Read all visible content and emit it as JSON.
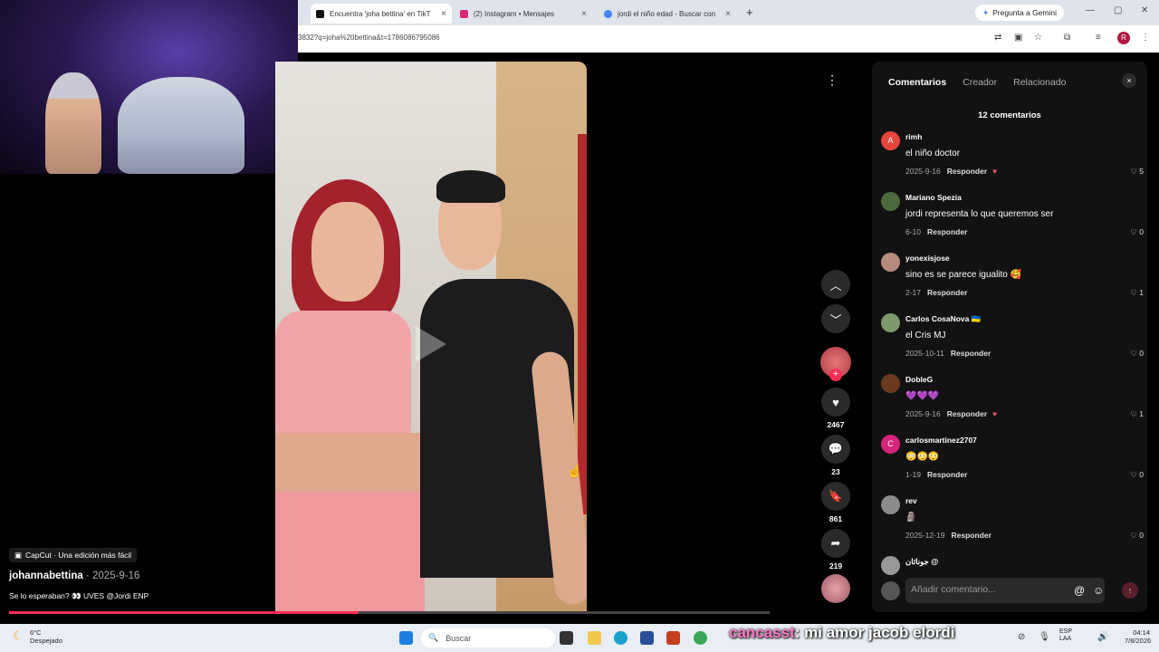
{
  "browser": {
    "tabs": [
      {
        "title": "Encuentra 'joha bettina' en TikT",
        "active": true
      },
      {
        "title": "(2) Instagram • Mensajes",
        "active": false
      },
      {
        "title": "jordi el niño edad - Buscar con",
        "active": false
      }
    ],
    "new_tab_glyph": "+",
    "gemini_label": "Pregunta a Gemini",
    "url": "3832?q=joha%20bettina&t=1786086795086",
    "profile_initial": "R",
    "close_glyph": "×"
  },
  "video": {
    "capcut_tag": "CapCut · Una edición más fácil",
    "author": "johannabettina",
    "date": "· 2025-9-16",
    "description": "Se lo esperaban? 👀 UVES @Jordi ENP",
    "progress": 0.46
  },
  "actions": {
    "likes": "2467",
    "comments": "23",
    "saves": "861",
    "shares": "219"
  },
  "panel": {
    "tabs": [
      "Comentarios",
      "Creador",
      "Relacionado"
    ],
    "count_label": "12 comentarios",
    "reply_label": "Responder",
    "input_placeholder": "Añadir comentario...",
    "comments": [
      {
        "user": "rimh",
        "text": "el niño doctor",
        "date": "2025-9-16",
        "likes": "5",
        "avatar": "A",
        "avatar_color": "#e8453c",
        "creator_liked": true
      },
      {
        "user": "Mariano Spezia",
        "text": "jordi representa lo que queremos ser",
        "date": "6-10",
        "likes": "0",
        "avatar": "",
        "avatar_color": "#4c6b3c",
        "creator_liked": false
      },
      {
        "user": "yonexisjose",
        "text": "sino es se parece igualito 🥰",
        "date": "2-17",
        "likes": "1",
        "avatar": "",
        "avatar_color": "#b88a7d",
        "creator_liked": false
      },
      {
        "user": "Carlos CosaNova 🇺🇦",
        "text": "el Cris MJ",
        "date": "2025-10-11",
        "likes": "0",
        "avatar": "",
        "avatar_color": "#7d9a6b",
        "creator_liked": false
      },
      {
        "user": "DobleG",
        "text": "💜💜💜",
        "date": "2025-9-16",
        "likes": "1",
        "avatar": "",
        "avatar_color": "#6b3a1e",
        "creator_liked": true
      },
      {
        "user": "carlosmartinez2707",
        "text": "😳😳😳",
        "date": "1-19",
        "likes": "0",
        "avatar": "C",
        "avatar_color": "#d6247a",
        "creator_liked": false
      },
      {
        "user": "rev",
        "text": "🗿",
        "date": "2025-12-19",
        "likes": "0",
        "avatar": "",
        "avatar_color": "#8c8c8c",
        "creator_liked": false
      },
      {
        "user": "جوناثان @",
        "text": "",
        "date": "",
        "likes": "",
        "avatar": "",
        "avatar_color": "#999999",
        "creator_liked": false
      }
    ]
  },
  "taskbar": {
    "temp": "6°C",
    "weather": "Despejado",
    "search_label": "Buscar",
    "lang_top": "ESP",
    "lang_bottom": "LAA",
    "time": "04:14",
    "date": "7/8/2026"
  },
  "stream_chat": {
    "user": "cancasst",
    "message": ": mi amor jacob elordi"
  },
  "colors": {
    "accent": "#fe2c55",
    "panel_bg": "#121212",
    "page_bg": "#000000"
  }
}
